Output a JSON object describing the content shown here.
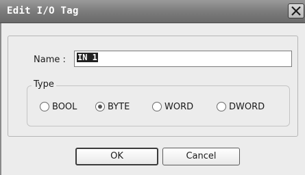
{
  "window": {
    "title": "Edit I/O Tag",
    "close_icon": "close-icon"
  },
  "name_field": {
    "label": "Name :",
    "value": "IN 1"
  },
  "type_group": {
    "legend": "Type",
    "options": [
      {
        "label": "BOOL",
        "selected": false
      },
      {
        "label": "BYTE",
        "selected": true
      },
      {
        "label": "WORD",
        "selected": false
      },
      {
        "label": "DWORD",
        "selected": false
      }
    ]
  },
  "buttons": {
    "ok_label": "OK",
    "cancel_label": "Cancel"
  },
  "colors": {
    "titlebar": "#7c7c7c",
    "dialog_background": "#ececec"
  }
}
